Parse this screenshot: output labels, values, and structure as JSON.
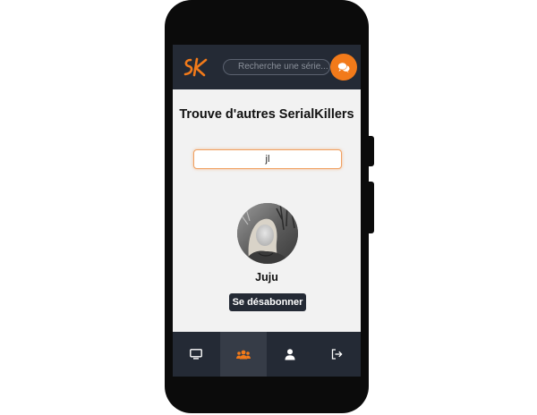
{
  "header": {
    "logo_text": "SK",
    "search_placeholder": "Recherche une série..."
  },
  "main": {
    "title": "Trouve d'autres SerialKillers",
    "search_value": "jl",
    "results": [
      {
        "username": "Juju",
        "action_label": "Se désabonner"
      }
    ]
  },
  "nav": {
    "items": [
      {
        "icon": "monitor-icon",
        "active": false
      },
      {
        "icon": "users-icon",
        "active": true
      },
      {
        "icon": "user-icon",
        "active": false
      },
      {
        "icon": "logout-icon",
        "active": false
      }
    ]
  },
  "colors": {
    "accent": "#f27a1a",
    "bar": "#242a35",
    "background": "#f2f2f2"
  }
}
